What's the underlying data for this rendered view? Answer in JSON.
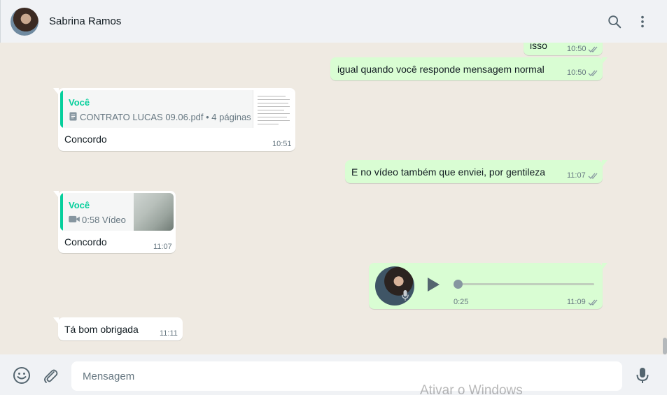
{
  "header": {
    "contact_name": "Sabrina Ramos"
  },
  "messages": {
    "m1": {
      "text": "isso",
      "time": "10:50"
    },
    "m2": {
      "text": "igual quando você responde mensagem normal",
      "time": "10:50"
    },
    "m3": {
      "quote_author": "Você",
      "quote_text": "CONTRATO LUCAS 09.06.pdf • 4 páginas",
      "text": "Concordo",
      "time": "10:51"
    },
    "m4": {
      "text": "E no vídeo também que enviei, por gentileza",
      "time": "11:07"
    },
    "m5": {
      "quote_author": "Você",
      "quote_text": "0:58 Vídeo",
      "text": "Concordo",
      "time": "11:07"
    },
    "m6": {
      "duration": "0:25",
      "time": "11:09",
      "progress": 0
    },
    "m7": {
      "text": "Tá bom obrigada",
      "time": "11:11"
    }
  },
  "composer": {
    "placeholder": "Mensagem"
  },
  "watermark": "Ativar o Windows",
  "colors": {
    "outgoing_bubble": "#d9fdd3",
    "incoming_bubble": "#ffffff",
    "accent": "#06cf9c",
    "background": "#efeae2"
  },
  "icons": [
    "search-icon",
    "menu-icon",
    "double-check-icon",
    "document-icon",
    "video-camera-icon",
    "play-icon",
    "microphone-icon",
    "emoji-icon",
    "attach-icon"
  ]
}
